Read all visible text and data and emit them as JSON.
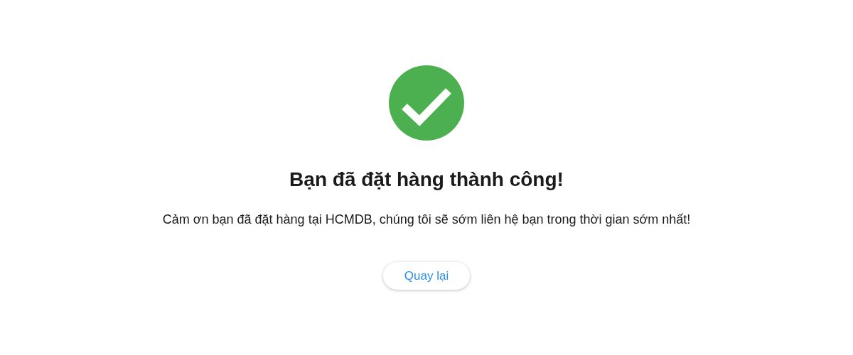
{
  "title": "Bạn đã đặt hàng thành công!",
  "message": "Cảm ơn bạn đã đặt hàng tại HCMDB, chúng tôi sẽ sớm liên hệ bạn trong thời gian sớm nhất!",
  "button": {
    "label": "Quay lại"
  }
}
